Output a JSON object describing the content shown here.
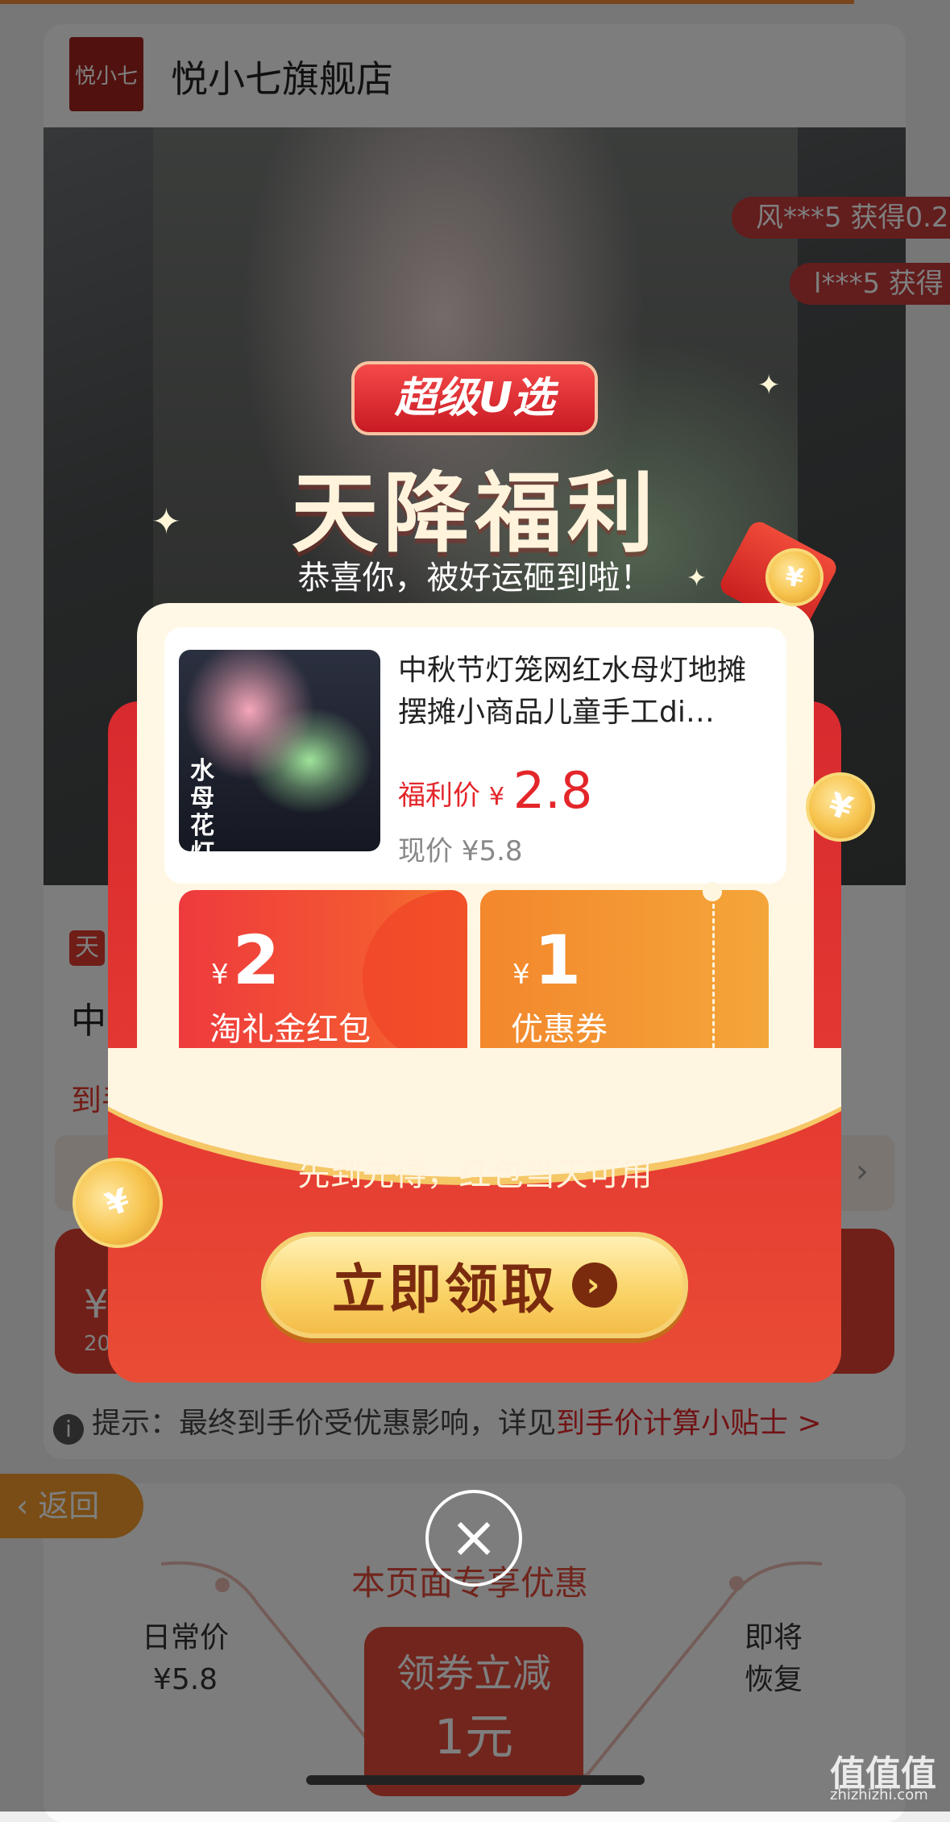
{
  "store": {
    "logo_text": "悦小七",
    "name": "悦小七旗舰店"
  },
  "tickers": [
    "风***5 获得0.2",
    "l***5 获得"
  ],
  "background": {
    "tag": "天",
    "title_fragment": "中",
    "price_fragment": "到手",
    "bar_yen": "¥",
    "bar_sub": "20",
    "tip_prefix": "提示：最终到手价受优惠影响，详见",
    "tip_link": "到手价计算小贴士 >",
    "back_label": "返回",
    "exclusive_title": "本页面专享优惠",
    "daily_label": "日常价",
    "daily_price": "¥5.8",
    "soon_label_1": "即将",
    "soon_label_2": "恢复",
    "coupon_line1": "领券立减",
    "coupon_line2": "1元"
  },
  "modal": {
    "badge": "超级U选",
    "headline": "天降福利",
    "subline": "恭喜你，被好运砸到啦！",
    "product": {
      "image_caption": "水母花灯",
      "title": "中秋节灯笼网红水母灯地摊摆摊小商品儿童手工di…",
      "welfare_label": "福利价",
      "welfare_yen": "¥",
      "welfare_price": "2.8",
      "original_label": "现价 ¥5.8"
    },
    "coupons": [
      {
        "yen": "¥",
        "amount": "2",
        "label": "淘礼金红包"
      },
      {
        "yen": "¥",
        "amount": "1",
        "label": "优惠券"
      }
    ],
    "rule_text": "先到先得，红包当天可用",
    "claim_button": "立即领取",
    "close_symbol": "×",
    "coin_symbol": "¥"
  },
  "watermark": {
    "title": "值值值",
    "url": "zhizhizhi.com"
  },
  "colors": {
    "primary_red": "#e3262a",
    "accent_orange": "#f39a2b",
    "gold": "#f6c24a"
  }
}
